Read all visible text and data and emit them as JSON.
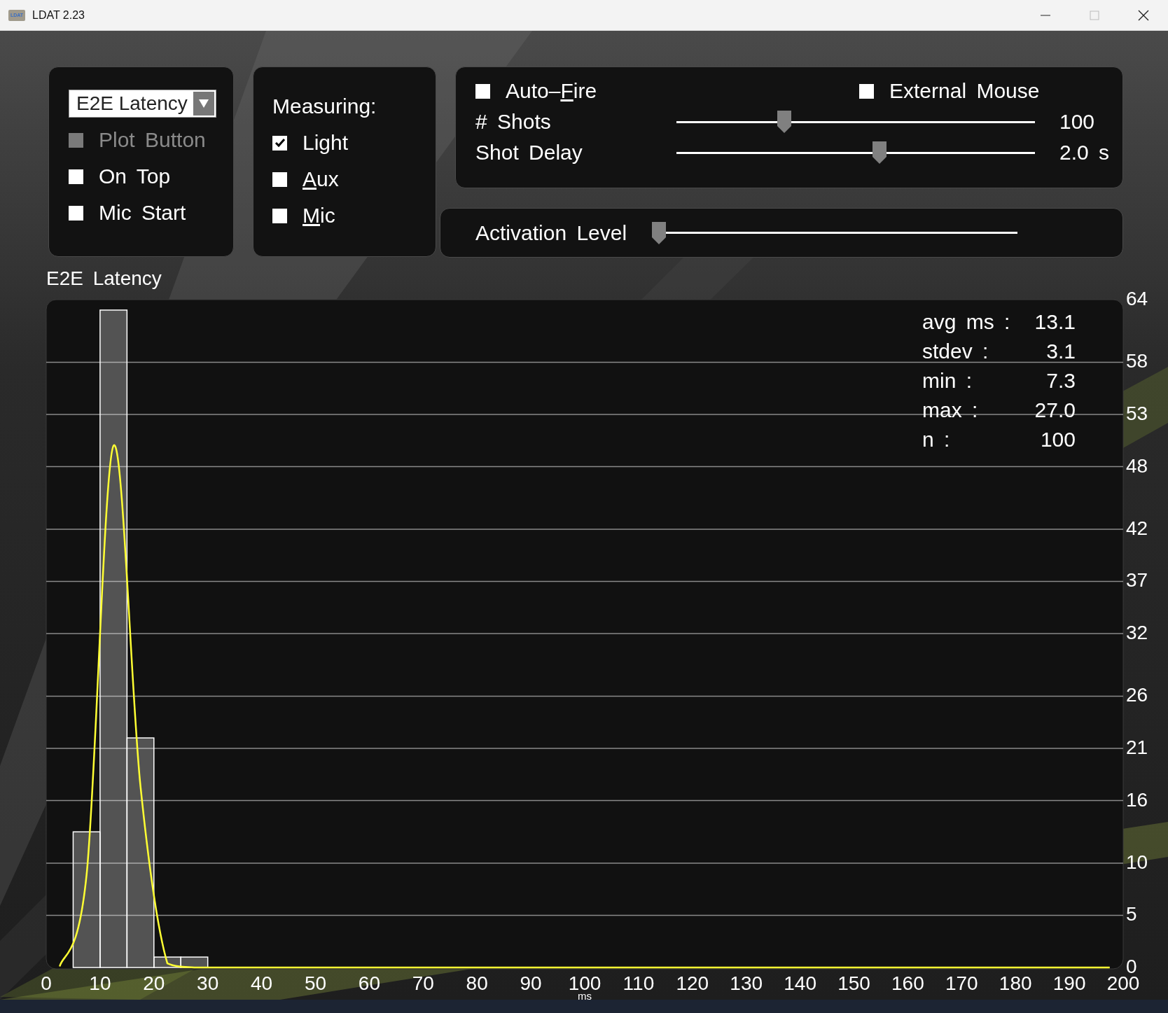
{
  "window": {
    "title": "LDAT 2.23",
    "icon_text": "LDAT",
    "controls": [
      {
        "kind": "minimize",
        "disabled": false
      },
      {
        "kind": "maximize",
        "disabled": true
      },
      {
        "kind": "close",
        "disabled": false
      }
    ]
  },
  "mode_panel": {
    "dropdown": {
      "value": "E2E Latency"
    },
    "options": [
      {
        "label": "Plot Button",
        "checked": false,
        "disabled": true
      },
      {
        "label": "On Top",
        "checked": false,
        "disabled": false
      },
      {
        "label": "Mic Start",
        "checked": false,
        "disabled": false
      }
    ]
  },
  "measuring_panel": {
    "title": "Measuring:",
    "options": [
      {
        "before": "Light",
        "checked": true
      },
      {
        "key": "A",
        "after": "ux",
        "checked": false
      },
      {
        "key": "M",
        "after": "ic",
        "checked": false
      }
    ]
  },
  "fire_panel": {
    "auto_fire": {
      "before": "Auto–",
      "key": "F",
      "after": "ire",
      "checked": false
    },
    "external_mouse": {
      "label": "External Mouse",
      "checked": false
    },
    "sliders": [
      {
        "label": "# Shots",
        "level": 0.3,
        "reading": "100"
      },
      {
        "label": "Shot Delay",
        "level": 0.567,
        "reading": "2.0 s"
      }
    ]
  },
  "activation_panel": {
    "label": "Activation Level",
    "level": 0.0
  },
  "chart": {
    "title": "E2E Latency",
    "stats": [
      {
        "label": "avg ms :",
        "value": "13.1"
      },
      {
        "label": "stdev :",
        "value": "3.1"
      },
      {
        "label": "min :",
        "value": "7.3"
      },
      {
        "label": "max :",
        "value": "27.0"
      },
      {
        "label": "n :",
        "value": "100"
      }
    ],
    "chart_data": {
      "type": "bar",
      "xlabel": "ms",
      "x": [
        2.5,
        7.5,
        12.5,
        17.5,
        22.5,
        27.5,
        32.5,
        37.5,
        42.5,
        47.5,
        52.5,
        57.5,
        62.5,
        67.5,
        72.5,
        77.5,
        82.5,
        87.5,
        92.5,
        97.5,
        102.5,
        107.5,
        112.5,
        117.5,
        122.5,
        127.5,
        132.5,
        137.5,
        142.5,
        147.5,
        152.5,
        157.5,
        162.5,
        167.5,
        172.5,
        177.5,
        182.5,
        187.5,
        192.5,
        197.5
      ],
      "grid": true,
      "series": [
        {
          "type": "bar",
          "color": "#ffffff",
          "values": [
            0,
            13,
            63,
            22,
            1,
            1,
            0,
            0,
            0,
            0,
            0,
            0,
            0,
            0,
            0,
            0,
            0,
            0,
            0,
            0,
            0,
            0,
            0,
            0,
            0,
            0,
            0,
            0,
            0,
            0,
            0,
            0,
            0,
            0,
            0,
            0,
            0,
            0,
            0,
            0
          ]
        },
        {
          "type": "line",
          "color": "#ffff33",
          "values": [
            0.1,
            8.9,
            50,
            17.4,
            0.4,
            0,
            0,
            0,
            0,
            0,
            0,
            0,
            0,
            0,
            0,
            0,
            0,
            0,
            0,
            0,
            0,
            0,
            0,
            0,
            0,
            0,
            0,
            0,
            0,
            0,
            0,
            0,
            0,
            0,
            0,
            0,
            0,
            0,
            0,
            0
          ]
        }
      ],
      "xlim": [
        0,
        200
      ],
      "ylim": [
        0,
        64
      ],
      "xticks": [
        0,
        10,
        20,
        30,
        40,
        50,
        60,
        70,
        80,
        90,
        100,
        110,
        120,
        130,
        140,
        150,
        160,
        170,
        180,
        190,
        200
      ],
      "yticks": [
        0,
        5,
        10,
        16,
        21,
        26,
        32,
        37,
        42,
        48,
        53,
        58,
        64
      ]
    }
  }
}
